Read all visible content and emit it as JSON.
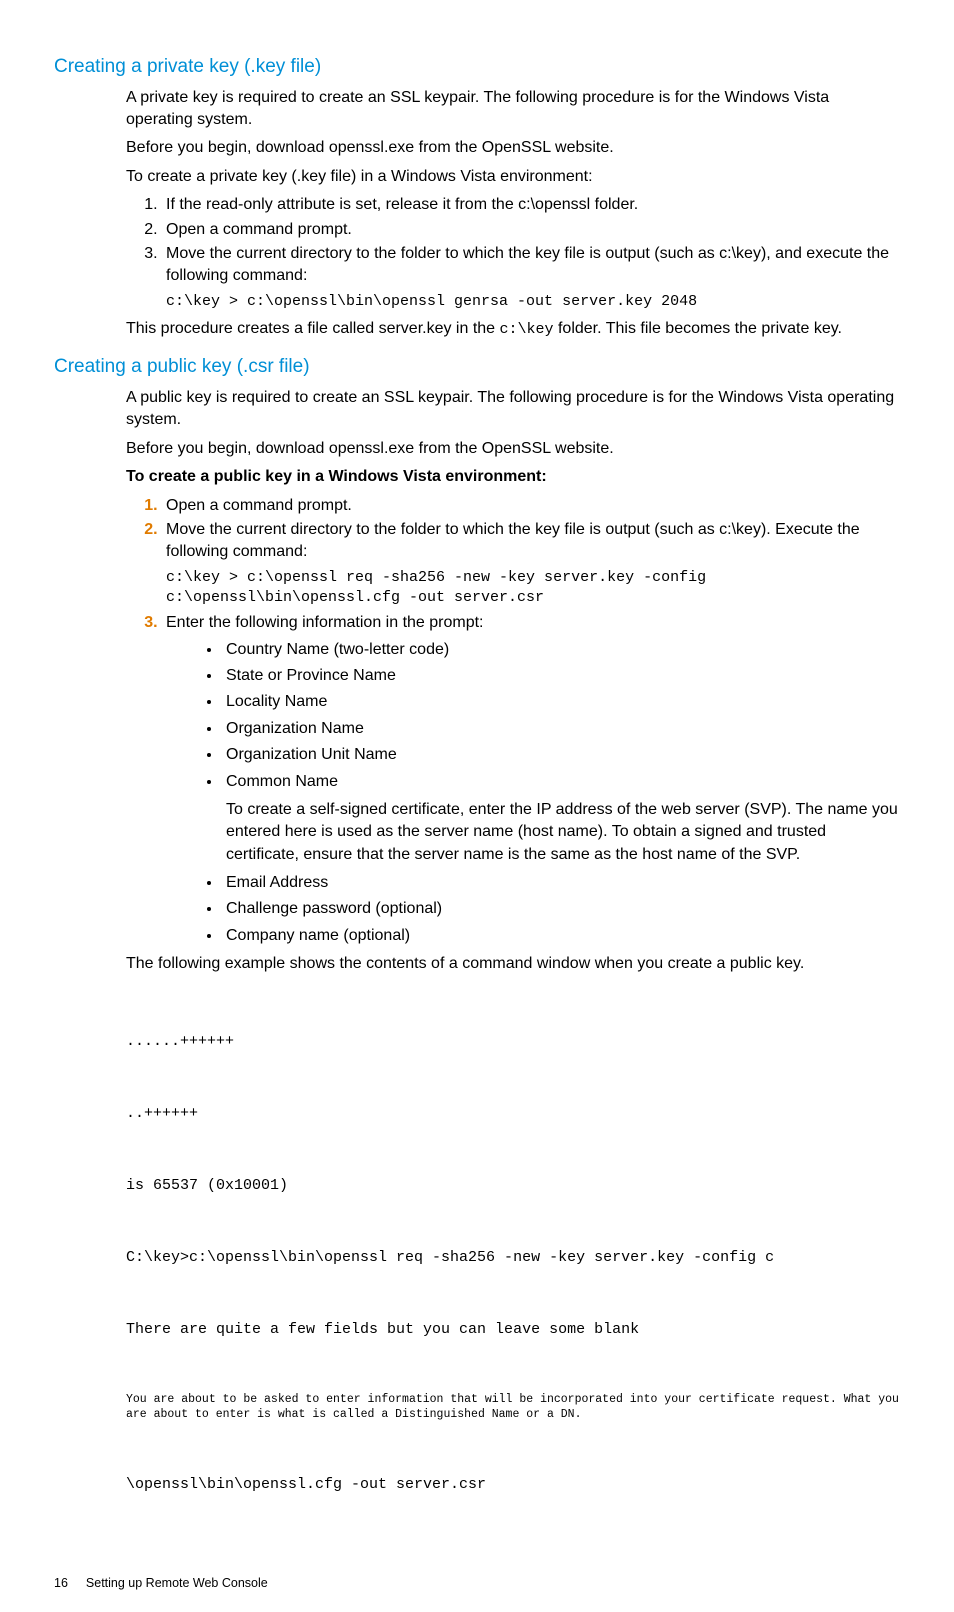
{
  "s1": {
    "heading": "Creating a private key (.key file)",
    "p1": "A private key is required to create an SSL keypair. The following procedure is for the Windows Vista operating system.",
    "p2": "Before you begin, download openssl.exe from the OpenSSL website.",
    "p3": "To create a private key (.key file) in a Windows Vista environment:",
    "li1": "If the read-only attribute is set, release it from the c:\\openssl folder.",
    "li2": "Open a command prompt.",
    "li3": "Move the current directory to the folder to which the key file is output (such as c:\\key), and execute the following command:",
    "code1": "c:\\key > c:\\openssl\\bin\\openssl genrsa -out server.key 2048",
    "p4a": "This procedure creates a file called server.key in the ",
    "p4code": "c:\\key",
    "p4b": " folder. This file becomes the private key."
  },
  "s2": {
    "heading": "Creating a public key (.csr file)",
    "p1": "A public key is required to create an SSL keypair. The following procedure is for the Windows Vista operating system.",
    "p2": "Before you begin, download openssl.exe from the OpenSSL website.",
    "p3": "To create a public key in a Windows Vista environment:",
    "li1": "Open a command prompt.",
    "li2": "Move the current directory to the folder to which the key file is output (such as c:\\key). Execute the following command:",
    "code1": "c:\\key > c:\\openssl req -sha256 -new -key server.key -config c:\\openssl\\bin\\openssl.cfg -out server.csr",
    "li3": "Enter the following information in the prompt:",
    "b1": "Country Name (two-letter code)",
    "b2": "State or Province Name",
    "b3": "Locality Name",
    "b4": "Organization Name",
    "b5": "Organization Unit Name",
    "b6": "Common Name",
    "b6note": "To create a self-signed certificate, enter the IP address of the web server (SVP). The name you entered here is used as the server name (host name). To obtain a signed and trusted certificate, ensure that the server name is the same as the host name of the SVP.",
    "b7": "Email Address",
    "b8": "Challenge password (optional)",
    "b9": "Company name (optional)",
    "p4": "The following example shows the contents of a command window when you create a public key.",
    "ex1": "......++++++",
    "ex2": "..++++++",
    "ex3": "is 65537 (0x10001)",
    "ex4": "C:\\key>c:\\openssl\\bin\\openssl req -sha256 -new -key server.key -config c",
    "ex5": "There are quite a few fields but you can leave some blank",
    "ex6": "You are about to be asked to enter information that will be incorporated into your certificate request. What you are about to enter is what is called a Distinguished Name or a DN.",
    "ex7": "\\openssl\\bin\\openssl.cfg -out server.csr"
  },
  "footer": {
    "page": "16",
    "title": "Setting up Remote Web Console"
  }
}
